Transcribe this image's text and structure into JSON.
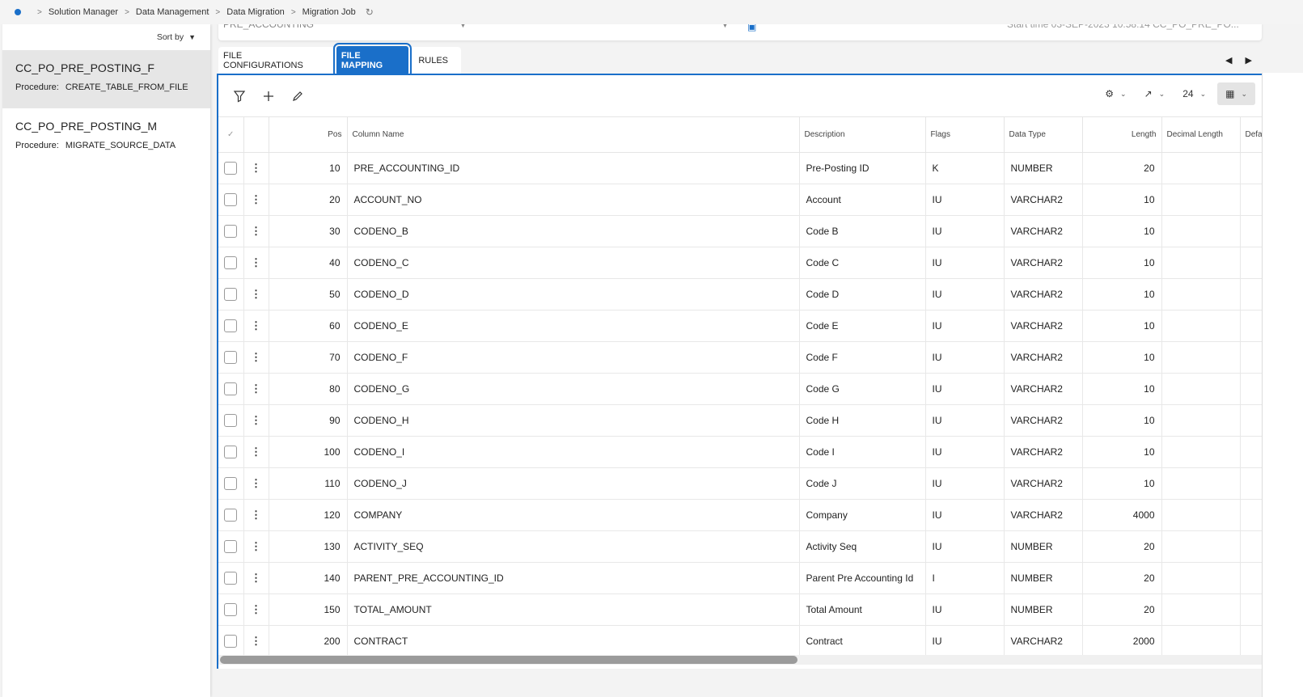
{
  "breadcrumb": {
    "items": [
      "Solution Manager",
      "Data Management",
      "Data Migration",
      "Migration Job"
    ]
  },
  "sidebar": {
    "sort_label": "Sort by",
    "items": [
      {
        "title": "CC_PO_PRE_POSTING_F",
        "procedure_label": "Procedure:",
        "procedure": "CREATE_TABLE_FROM_FILE"
      },
      {
        "title": "CC_PO_PRE_POSTING_M",
        "procedure_label": "Procedure:",
        "procedure": "MIGRATE_SOURCE_DATA"
      }
    ]
  },
  "header_fragment": {
    "left_value": "PRE_ACCOUNTING",
    "right_text": "Start time   03-SEP-2023 10:58:14   CC_PO_PRE_PO..."
  },
  "tabs": [
    {
      "label": "FILE CONFIGURATIONS"
    },
    {
      "label": "FILE MAPPING"
    },
    {
      "label": "RULES"
    }
  ],
  "toolbar": {
    "page_size": "24"
  },
  "table": {
    "headers": {
      "pos": "Pos",
      "column_name": "Column Name",
      "description": "Description",
      "flags": "Flags",
      "data_type": "Data Type",
      "length": "Length",
      "decimal_length": "Decimal Length",
      "default": "Defa"
    },
    "rows": [
      {
        "pos": "10",
        "column_name": "PRE_ACCOUNTING_ID",
        "description": "Pre-Posting ID",
        "flags": "K",
        "data_type": "NUMBER",
        "length": "20"
      },
      {
        "pos": "20",
        "column_name": "ACCOUNT_NO",
        "description": "Account",
        "flags": "IU",
        "data_type": "VARCHAR2",
        "length": "10"
      },
      {
        "pos": "30",
        "column_name": "CODENO_B",
        "description": "Code B",
        "flags": "IU",
        "data_type": "VARCHAR2",
        "length": "10"
      },
      {
        "pos": "40",
        "column_name": "CODENO_C",
        "description": "Code C",
        "flags": "IU",
        "data_type": "VARCHAR2",
        "length": "10"
      },
      {
        "pos": "50",
        "column_name": "CODENO_D",
        "description": "Code D",
        "flags": "IU",
        "data_type": "VARCHAR2",
        "length": "10"
      },
      {
        "pos": "60",
        "column_name": "CODENO_E",
        "description": "Code E",
        "flags": "IU",
        "data_type": "VARCHAR2",
        "length": "10"
      },
      {
        "pos": "70",
        "column_name": "CODENO_F",
        "description": "Code F",
        "flags": "IU",
        "data_type": "VARCHAR2",
        "length": "10"
      },
      {
        "pos": "80",
        "column_name": "CODENO_G",
        "description": "Code G",
        "flags": "IU",
        "data_type": "VARCHAR2",
        "length": "10"
      },
      {
        "pos": "90",
        "column_name": "CODENO_H",
        "description": "Code H",
        "flags": "IU",
        "data_type": "VARCHAR2",
        "length": "10"
      },
      {
        "pos": "100",
        "column_name": "CODENO_I",
        "description": "Code I",
        "flags": "IU",
        "data_type": "VARCHAR2",
        "length": "10"
      },
      {
        "pos": "110",
        "column_name": "CODENO_J",
        "description": "Code J",
        "flags": "IU",
        "data_type": "VARCHAR2",
        "length": "10"
      },
      {
        "pos": "120",
        "column_name": "COMPANY",
        "description": "Company",
        "flags": "IU",
        "data_type": "VARCHAR2",
        "length": "4000"
      },
      {
        "pos": "130",
        "column_name": "ACTIVITY_SEQ",
        "description": "Activity Seq",
        "flags": "IU",
        "data_type": "NUMBER",
        "length": "20"
      },
      {
        "pos": "140",
        "column_name": "PARENT_PRE_ACCOUNTING_ID",
        "description": "Parent Pre Accounting Id",
        "flags": "I",
        "data_type": "NUMBER",
        "length": "20"
      },
      {
        "pos": "150",
        "column_name": "TOTAL_AMOUNT",
        "description": "Total Amount",
        "flags": "IU",
        "data_type": "NUMBER",
        "length": "20"
      },
      {
        "pos": "200",
        "column_name": "CONTRACT",
        "description": "Contract",
        "flags": "IU",
        "data_type": "VARCHAR2",
        "length": "2000"
      }
    ]
  },
  "colors": {
    "accent": "#1a6fc9"
  }
}
